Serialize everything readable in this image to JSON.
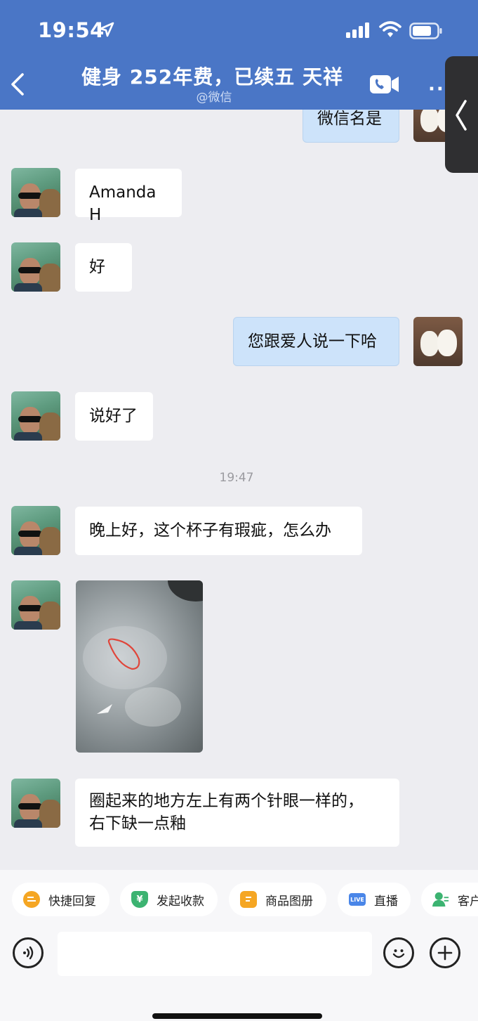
{
  "status_bar": {
    "time": "19:54"
  },
  "header": {
    "title": "健身  252年费，已续五 天祥",
    "subtitle": "@微信"
  },
  "messages": [
    {
      "side": "out",
      "text": "微信名是"
    },
    {
      "side": "in",
      "text": "Amanda H"
    },
    {
      "side": "in",
      "text": "好"
    },
    {
      "side": "out",
      "text": "您跟爱人说一下哈"
    },
    {
      "side": "in",
      "text": "说好了"
    },
    {
      "type": "timestamp",
      "text": "19:47"
    },
    {
      "side": "in",
      "text": "晚上好，这个杯子有瑕疵，怎么办"
    },
    {
      "side": "in",
      "type": "image",
      "alt": "photo-of-cup-defect"
    },
    {
      "side": "in",
      "line1": "圈起来的地方左上有两个针眼一样的，",
      "line2": "右下缺一点釉"
    }
  ],
  "quick_actions": [
    {
      "label": "快捷回复",
      "icon": "quick-reply-icon",
      "color": "#f5a623"
    },
    {
      "label": "发起收款",
      "icon": "yuan-icon",
      "color": "#3cb371"
    },
    {
      "label": "商品图册",
      "icon": "catalog-icon",
      "color": "#f5a623"
    },
    {
      "label": "直播",
      "icon": "live-icon",
      "color": "#4a86e8",
      "badge": "LIVE"
    },
    {
      "label": "客户",
      "icon": "customer-icon",
      "color": "#3cb371"
    }
  ],
  "input": {
    "placeholder": ""
  }
}
